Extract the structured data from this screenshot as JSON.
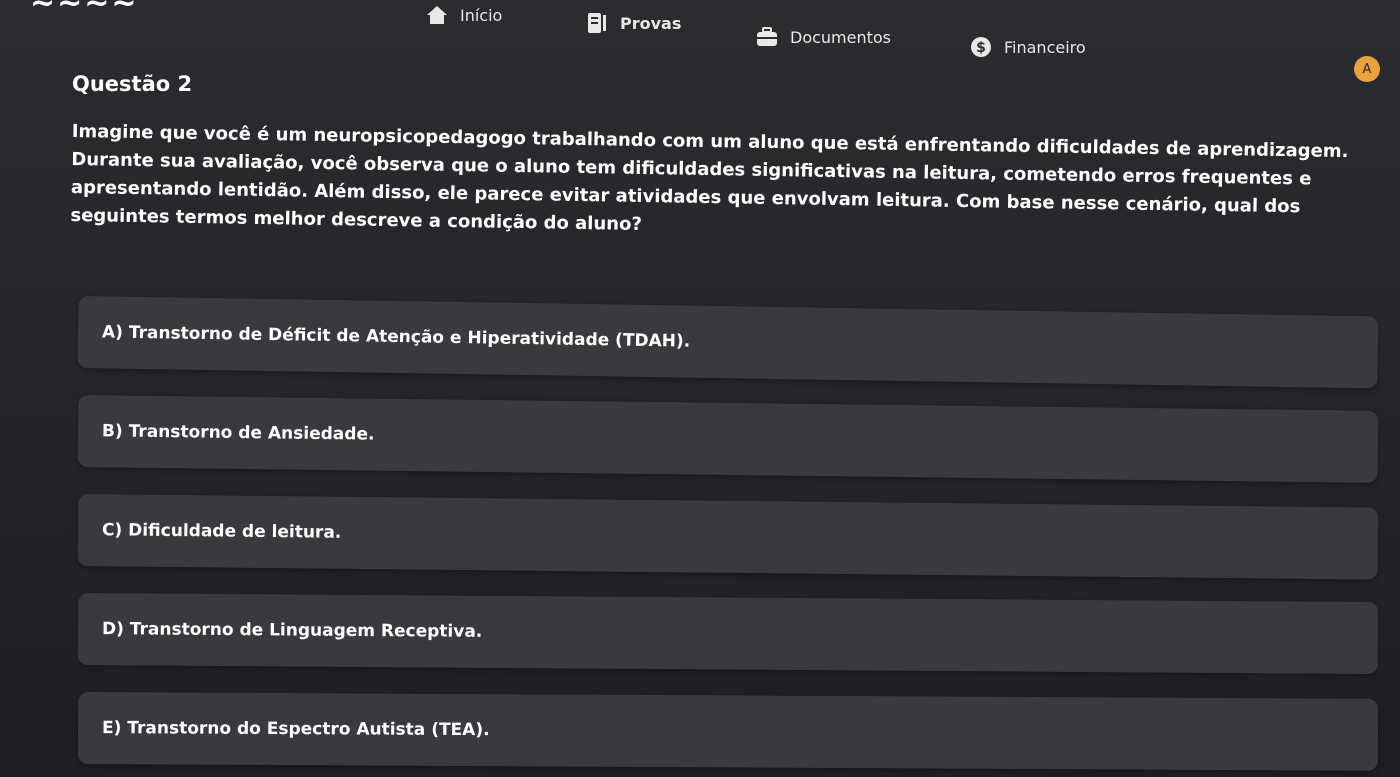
{
  "nav": {
    "items": [
      {
        "label": "Início",
        "icon": "home-icon"
      },
      {
        "label": "Provas",
        "icon": "exam-icon"
      },
      {
        "label": "Documentos",
        "icon": "briefcase-icon"
      },
      {
        "label": "Financeiro",
        "icon": "dollar-icon"
      }
    ]
  },
  "user": {
    "avatar_initial": "A",
    "avatar_color": "#e8a33d"
  },
  "question": {
    "title": "Questão 2",
    "text": "Imagine que você é um neuropsicopedagogo trabalhando com um aluno que está enfrentando dificuldades de aprendizagem. Durante sua avaliação, você observa que o aluno tem dificuldades significativas na leitura, cometendo erros frequentes e apresentando lentidão. Além disso, ele parece evitar atividades que envolvam leitura. Com base nesse cenário, qual dos seguintes termos melhor descreve a condição do aluno?"
  },
  "options": [
    {
      "label": "A) Transtorno de Déficit de Atenção e Hiperatividade (TDAH)."
    },
    {
      "label": "B) Transtorno de Ansiedade."
    },
    {
      "label": "C) Dificuldade de leitura."
    },
    {
      "label": "D) Transtorno de Linguagem Receptiva."
    },
    {
      "label": "E) Transtorno do Espectro Autista (TEA)."
    }
  ],
  "colors": {
    "background": "#232528",
    "option_background": "#383a3e",
    "text": "#ffffff"
  }
}
